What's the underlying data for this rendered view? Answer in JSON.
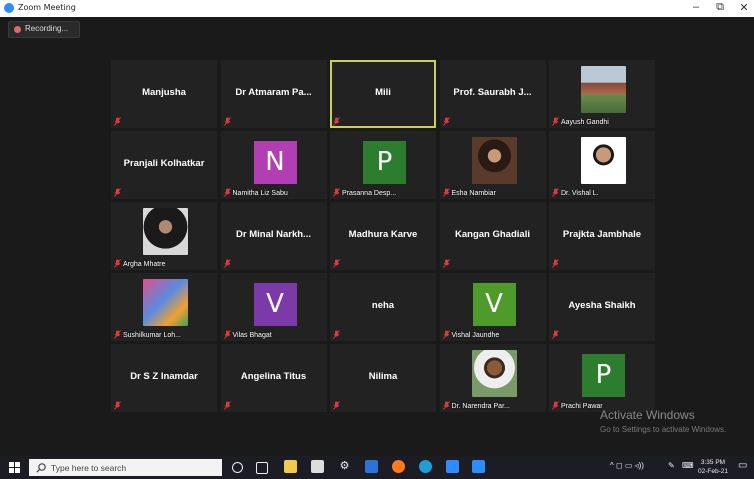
{
  "window": {
    "title": "Zoom Meeting",
    "minimize": "–",
    "restore": "⧉",
    "close": "✕"
  },
  "recording": {
    "label": "Recording..."
  },
  "participants": [
    {
      "display_name": "Manjusha",
      "label": ""
    },
    {
      "display_name": "Dr Atmaram Pa...",
      "label": ""
    },
    {
      "display_name": "Mili",
      "label": "",
      "active": true
    },
    {
      "display_name": "Prof. Saurabh J...",
      "label": ""
    },
    {
      "display_name": "",
      "label": "Aayush Gandhi",
      "photo": "house"
    },
    {
      "display_name": "Pranjali Kolhatkar",
      "label": ""
    },
    {
      "display_name": "",
      "label": "Namitha Liz Sabu",
      "avatar_letter": "N",
      "avatar_color": "#b13fb3"
    },
    {
      "display_name": "",
      "label": "Prasanna Desp...",
      "avatar_letter": "P",
      "avatar_color": "#2d7d2f"
    },
    {
      "display_name": "",
      "label": "Esha Nambiar",
      "photo": "person-dark"
    },
    {
      "display_name": "",
      "label": "Dr. Vishal L.",
      "photo": "person-light"
    },
    {
      "display_name": "",
      "label": "Argha Mhatre",
      "photo": "person-dark2"
    },
    {
      "display_name": "Dr Minal Narkh...",
      "label": ""
    },
    {
      "display_name": "Madhura Karve",
      "label": ""
    },
    {
      "display_name": "Kangan Ghadiali",
      "label": ""
    },
    {
      "display_name": "Prajkta Jambhale",
      "label": ""
    },
    {
      "display_name": "",
      "label": "Sushilkumar Loh...",
      "photo": "person-color"
    },
    {
      "display_name": "",
      "label": "Vilas Bhagat",
      "avatar_letter": "V",
      "avatar_color": "#7b3aa8"
    },
    {
      "display_name": "neha",
      "label": ""
    },
    {
      "display_name": "",
      "label": "Vishal Jaundhe",
      "avatar_letter": "V",
      "avatar_color": "#4e9a2a"
    },
    {
      "display_name": "Ayesha Shaikh",
      "label": ""
    },
    {
      "display_name": "Dr S Z Inamdar",
      "label": ""
    },
    {
      "display_name": "Angelina Titus",
      "label": ""
    },
    {
      "display_name": "Nilima",
      "label": ""
    },
    {
      "display_name": "",
      "label": "Dr. Narendra Par...",
      "photo": "person-outdoor"
    },
    {
      "display_name": "",
      "label": "Prachi Pawar",
      "avatar_letter": "P",
      "avatar_color": "#2d7d2f"
    }
  ],
  "watermark": {
    "title": "Activate Windows",
    "subtitle": "Go to Settings to activate Windows."
  },
  "taskbar": {
    "search_placeholder": "Type here to search",
    "clock_time": "3:35 PM",
    "clock_date": "02-Feb-21",
    "tray_icons": "^ ◻ ▭ ◃))"
  },
  "colors": {
    "mute_red": "#e03b3b",
    "active_border": "#c8d34a",
    "accent_blue": "#2d8cff"
  }
}
